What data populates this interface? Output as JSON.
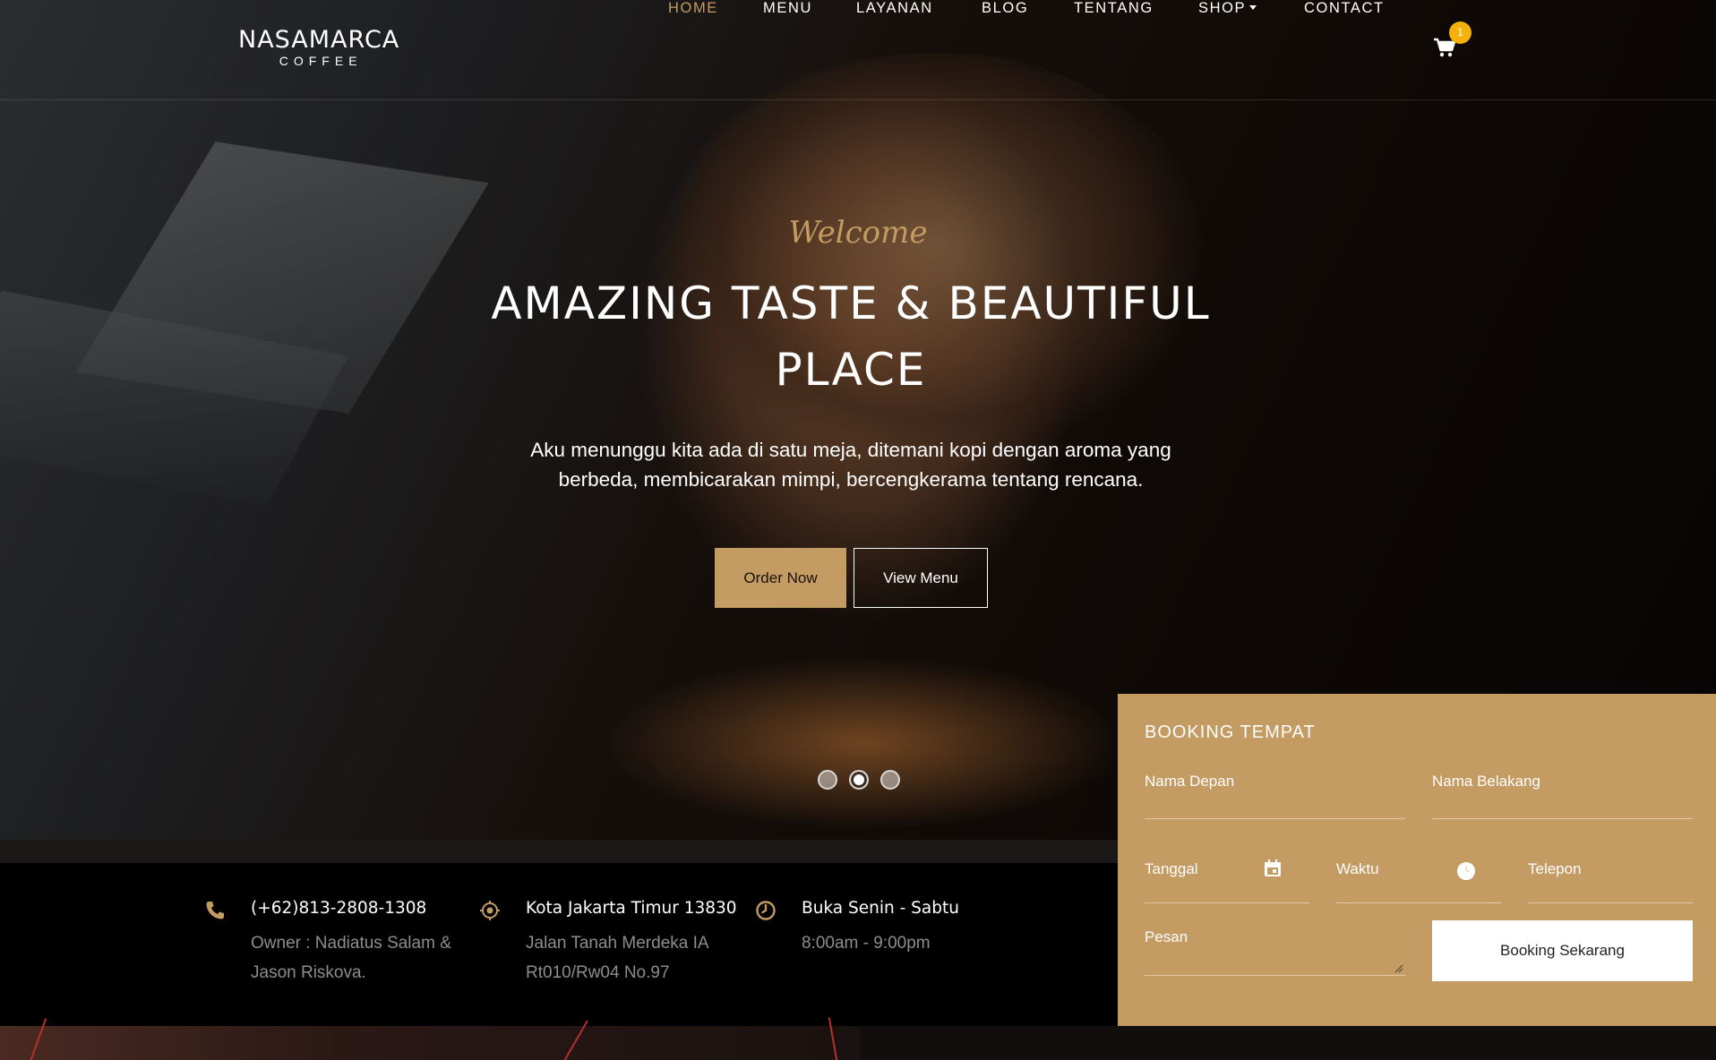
{
  "brand": {
    "name": "NASAMARCA",
    "tagline": "COFFEE"
  },
  "nav": {
    "items": [
      {
        "label": "HOME",
        "active": true
      },
      {
        "label": "MENU"
      },
      {
        "label": "LAYANAN"
      },
      {
        "label": "BLOG"
      },
      {
        "label": "TENTANG"
      },
      {
        "label": "SHOP",
        "dropdown": true
      },
      {
        "label": "CONTACT"
      }
    ],
    "cart_count": "1",
    "cart_icon": "shopping-cart-icon"
  },
  "hero": {
    "welcome": "Welcome",
    "headline_line1": "AMAZING TASTE & BEAUTIFUL",
    "headline_line2": "PLACE",
    "subtext_line1": "Aku menunggu kita ada di satu meja, ditemani kopi dengan aroma yang",
    "subtext_line2": "berbeda, membicarakan mimpi, bercengkerama tentang rencana.",
    "order_button": "Order Now",
    "view_button": "View Menu",
    "slides": 3,
    "active_slide": 2
  },
  "info": [
    {
      "icon": "phone-icon",
      "title": "(+62)813-2808-1308",
      "line1": "Owner : Nadiatus Salam &",
      "line2": "Jason Riskova."
    },
    {
      "icon": "location-icon",
      "title": "Kota Jakarta Timur 13830",
      "line1": "Jalan Tanah Merdeka IA",
      "line2": "Rt010/Rw04 No.97"
    },
    {
      "icon": "clock-icon",
      "title": "Buka Senin - Sabtu",
      "line1": "8:00am - 9:00pm",
      "line2": ""
    }
  ],
  "booking": {
    "title": "BOOKING TEMPAT",
    "first_name": "Nama Depan",
    "last_name": "Nama Belakang",
    "date": "Tanggal",
    "time": "Waktu",
    "phone": "Telepon",
    "message": "Pesan",
    "submit": "Booking Sekarang"
  },
  "colors": {
    "accent": "#c49b63",
    "badge": "#f5b10a",
    "info_bg": "#000000"
  }
}
